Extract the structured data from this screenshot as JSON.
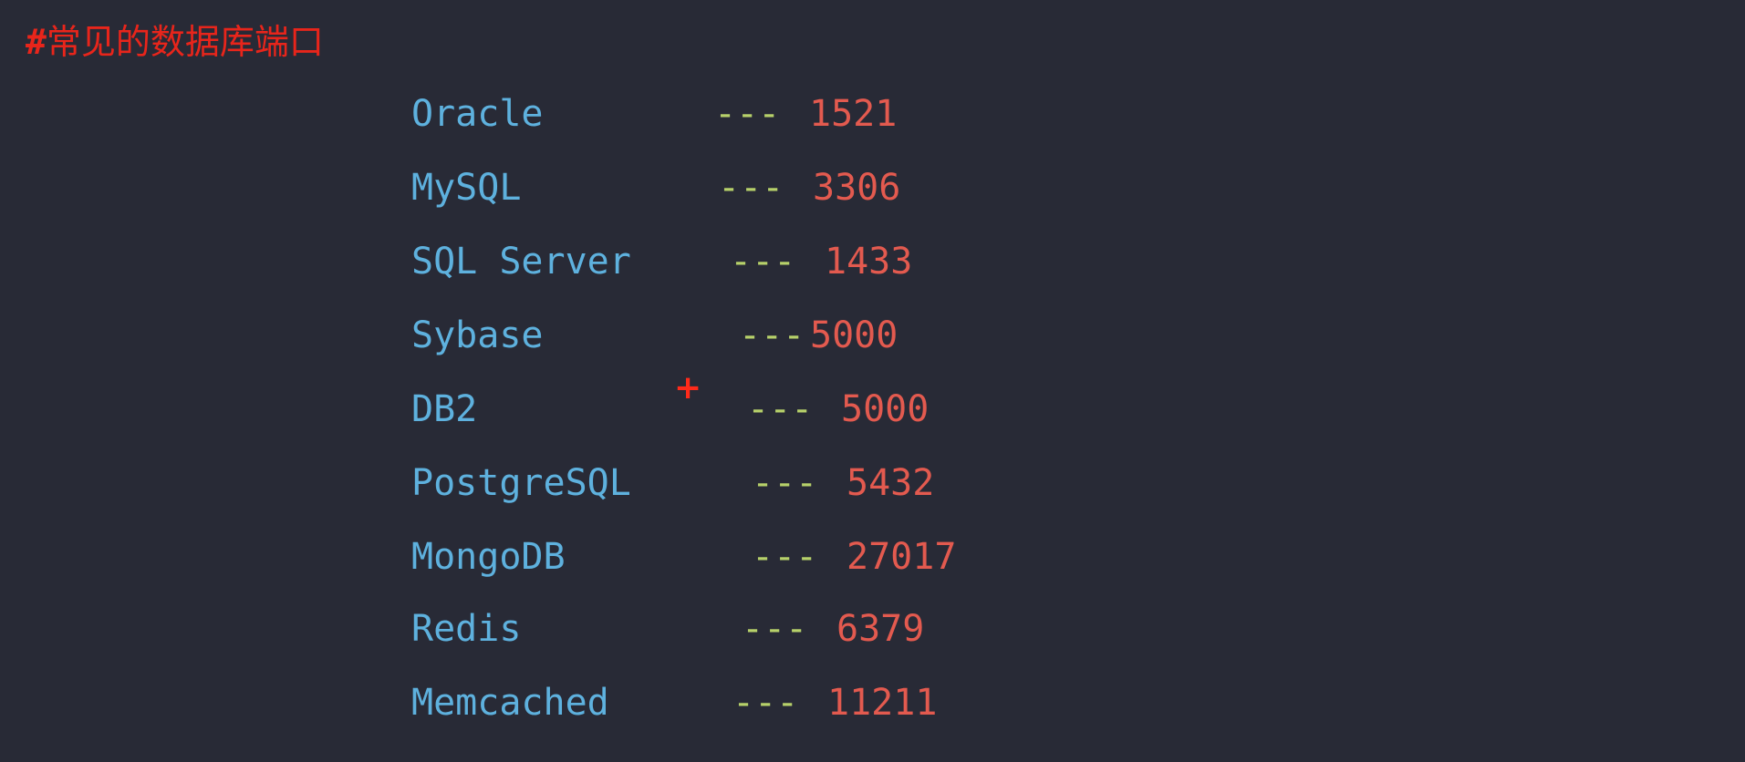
{
  "heading": {
    "hash": "#",
    "text": "常见的数据库端口"
  },
  "marker": {
    "symbol": "+"
  },
  "entries": [
    {
      "name": "Oracle",
      "dash": "---",
      "port": "1521"
    },
    {
      "name": "MySQL",
      "dash": "---",
      "port": "3306"
    },
    {
      "name": "SQL Server",
      "dash": "---",
      "port": "1433"
    },
    {
      "name": "Sybase",
      "dash": "---",
      "port": "5000"
    },
    {
      "name": "DB2",
      "dash": "---",
      "port": "5000"
    },
    {
      "name": "PostgreSQL",
      "dash": "---",
      "port": "5432"
    },
    {
      "name": "MongoDB",
      "dash": "---",
      "port": "27017"
    },
    {
      "name": "Redis",
      "dash": "---",
      "port": "6379"
    },
    {
      "name": "Memcached",
      "dash": "---",
      "port": "11211"
    }
  ],
  "colors": {
    "background": "#282a36",
    "heading": "#e8251b",
    "name": "#5eb1de",
    "dash": "#b7d16a",
    "port": "#e35a4f"
  }
}
